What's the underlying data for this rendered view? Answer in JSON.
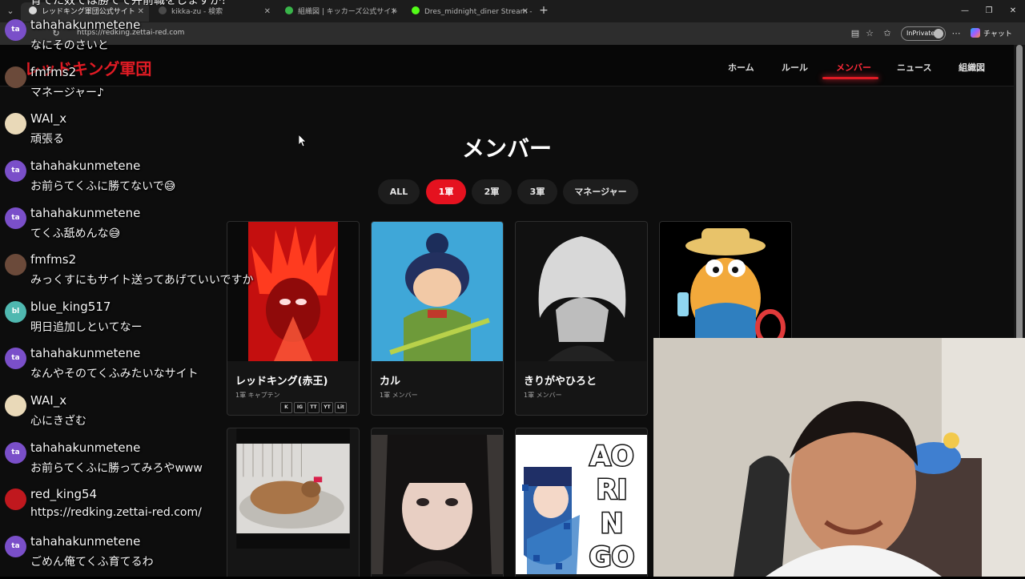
{
  "browser": {
    "tabs": [
      {
        "title": "レッドキング軍団公式サイト",
        "active": true,
        "favicon_color": "#d9d9d9"
      },
      {
        "title": "kikka-zu - 検索",
        "active": false,
        "favicon_color": "#4a4a4a"
      },
      {
        "title": "組織図 | キッカーズ公式サイト",
        "active": false,
        "favicon_color": "#39b54a"
      },
      {
        "title": "Dres_midnight_diner Stream - Wa",
        "active": false,
        "favicon_color": "#53fc18"
      }
    ],
    "close_glyph": "✕",
    "new_tab_glyph": "+",
    "url": "https://redking.zettai-red.com",
    "inprivate_label": "InPrivate",
    "copilot_label": "チャット"
  },
  "site": {
    "logo": "レッドキング軍団",
    "nav": [
      {
        "label": "ホーム",
        "active": false
      },
      {
        "label": "ルール",
        "active": false
      },
      {
        "label": "メンバー",
        "active": true
      },
      {
        "label": "ニュース",
        "active": false
      },
      {
        "label": "組織図",
        "active": false
      }
    ],
    "page_title": "メンバー",
    "filters": [
      {
        "label": "ALL",
        "active": false
      },
      {
        "label": "1軍",
        "active": true
      },
      {
        "label": "2軍",
        "active": false
      },
      {
        "label": "3軍",
        "active": false
      },
      {
        "label": "マネージャー",
        "active": false
      }
    ],
    "members": [
      {
        "name": "レッドキング(赤王)",
        "role": "1軍 キャプテン",
        "sns": [
          "K",
          "IG",
          "TT",
          "YT",
          "Lit"
        ]
      },
      {
        "name": "カル",
        "role": "1軍 メンバー"
      },
      {
        "name": "きりがやひろと",
        "role": "1軍 メンバー"
      },
      {
        "name": "",
        "role": ""
      },
      {
        "name": "",
        "role": ""
      },
      {
        "name": "",
        "role": ""
      },
      {
        "name": "",
        "role": "",
        "art_text": [
          "AO",
          "RI",
          "N",
          "GO"
        ]
      }
    ],
    "accent_color": "#e01b24"
  },
  "chat": {
    "top_partial": "育てた奴では勝てて弁前職をしますか？",
    "messages": [
      {
        "avatar": "ta",
        "user": "tahahakunmetene",
        "text": "なにそのさいと"
      },
      {
        "avatar": "",
        "user": "fmfms2",
        "text": "マネージャー♪"
      },
      {
        "avatar": "",
        "user": "WAI_x",
        "text": "頑張る"
      },
      {
        "avatar": "ta",
        "user": "tahahakunmetene",
        "text": "お前らてくふに勝てないで😅"
      },
      {
        "avatar": "ta",
        "user": "tahahakunmetene",
        "text": "てくふ舐めんな😅"
      },
      {
        "avatar": "",
        "user": "fmfms2",
        "text": "みっくすにもサイト送ってあげていいですか"
      },
      {
        "avatar": "bl",
        "user": "blue_king517",
        "text": "明日追加しといてなー"
      },
      {
        "avatar": "ta",
        "user": "tahahakunmetene",
        "text": "なんやそのてくふみたいなサイト"
      },
      {
        "avatar": "",
        "user": "WAI_x",
        "text": "心にきざむ"
      },
      {
        "avatar": "ta",
        "user": "tahahakunmetene",
        "text": "お前らてくふに勝ってみろやwww"
      },
      {
        "avatar": "",
        "user": "red_king54",
        "text": "https://redking.zettai-red.com/"
      },
      {
        "avatar": "ta",
        "user": "tahahakunmetene",
        "text": "ごめん俺てくふ育てるわ"
      }
    ]
  }
}
